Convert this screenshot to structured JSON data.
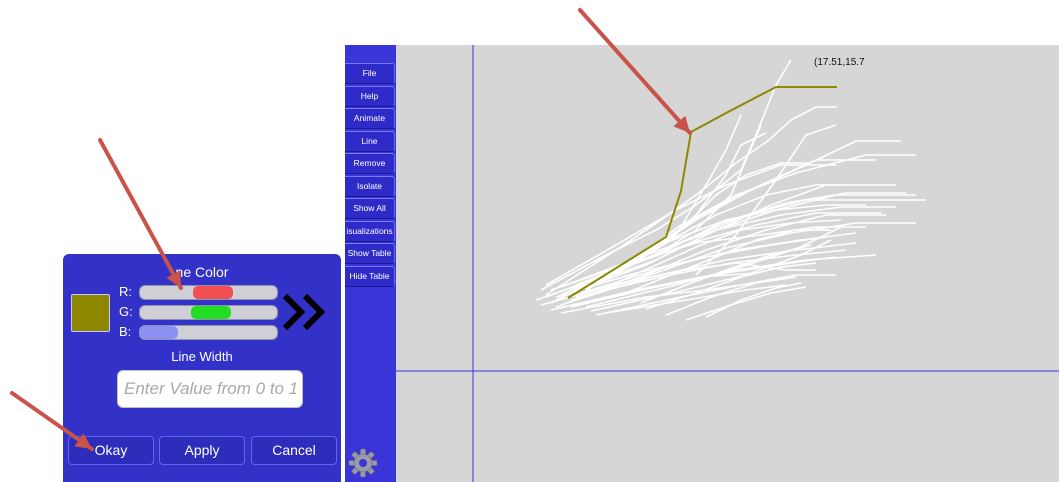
{
  "sidebar": {
    "items": [
      {
        "label": "File"
      },
      {
        "label": "Help"
      },
      {
        "label": "Animate"
      },
      {
        "label": "Line"
      },
      {
        "label": "Remove"
      },
      {
        "label": "Isolate"
      },
      {
        "label": "Show All"
      },
      {
        "label": "isualizations"
      },
      {
        "label": "Show Table"
      },
      {
        "label": "Hide Table"
      }
    ],
    "settings_icon": "gear-icon"
  },
  "plot": {
    "coordinate_readout": "(17.51,15.7",
    "background": "#d6d6d6",
    "line_color": "#ffffff",
    "highlight_color": "#8e8700",
    "axis_color": "#3a35d8"
  },
  "dialog": {
    "title": "ne Color",
    "swatch_color": "#8e8700",
    "channels": {
      "r": {
        "label": "R:",
        "color": "#f05050",
        "value": 0.55
      },
      "g": {
        "label": "G:",
        "color": "#22dd22",
        "value": 0.53
      },
      "b": {
        "label": "B:",
        "color": "#8c90f0",
        "value": 0.0
      }
    },
    "line_width_label": "Line Width",
    "line_width_placeholder": "Enter Value from 0 to 1",
    "line_width_value": "",
    "buttons": {
      "okay": "Okay",
      "apply": "Apply",
      "cancel": "Cancel"
    },
    "next_icon": "double-chevron-right-icon"
  },
  "annotations": {
    "arrow_color": "#c9534a"
  }
}
